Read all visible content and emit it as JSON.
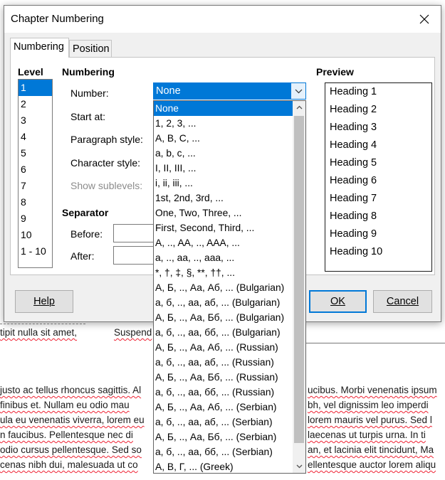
{
  "document": {
    "lines": [
      "justo ac tellus rhoncus sagittis. Al",
      "finibus et. Nullam eu odio mau",
      "ula eu venenatis viverra, lorem eu",
      "n faucibus. Pellentesque nec di",
      "odio cursus pellentesque. Sed so",
      "cenas nibh dui, malesuada ut co"
    ],
    "right_lines": [
      "ucibus. Morbi venenatis ipsum",
      "bh, vel dignissim leo imperdi",
      "lorem mauris vel purus. Sed l",
      "laecenas ut turpis urna. In ti",
      "an, et lacinia elit tincidunt, Ma",
      "ellentesque auctor lorem aliqu"
    ],
    "under_dialog_left": "tipit nulla sit amet,",
    "under_dialog_right": "Suspend"
  },
  "dialog": {
    "title": "Chapter Numbering",
    "tabs": [
      "Numbering",
      "Position"
    ],
    "level_header": "Level",
    "levels": [
      "1",
      "2",
      "3",
      "4",
      "5",
      "6",
      "7",
      "8",
      "9",
      "10",
      "1 - 10"
    ],
    "selected_level": "1",
    "numbering_header": "Numbering",
    "number_label": "Number:",
    "start_at_label": "Start at:",
    "paragraph_style_label": "Paragraph style:",
    "character_style_label": "Character style:",
    "show_sublevels_label": "Show sublevels:",
    "separator_header": "Separator",
    "before_label": "Before:",
    "after_label": "After:",
    "preview_header": "Preview",
    "preview": [
      "Heading 1",
      "Heading 2",
      "Heading 3",
      "Heading 4",
      "Heading 5",
      "Heading 6",
      "Heading 7",
      "Heading 8",
      "Heading 9",
      "Heading 10"
    ],
    "number_value": "None",
    "buttons": {
      "help": "Help",
      "ok": "OK",
      "cancel": "Cancel"
    }
  },
  "number_dropdown": {
    "selected": "None",
    "options": [
      "None",
      "1, 2, 3, ...",
      "A, B, C, ...",
      "a, b, c, ...",
      "I, II, III, ...",
      "i, ii, iii, ...",
      "1st, 2nd, 3rd, ...",
      "One, Two, Three, ...",
      "First, Second, Third, ...",
      "A, .., AA, .., AAA, ...",
      "a, .., aa, .., aaa, ...",
      "*, †, ‡, §, **, ††, ...",
      "А, Б, .., Аа, Аб, ... (Bulgarian)",
      "а, б, .., аа, аб, ... (Bulgarian)",
      "А, Б, .., Аа, Бб, ... (Bulgarian)",
      "а, б, .., аа, бб, ... (Bulgarian)",
      "А, Б, .., Аа, Аб, ... (Russian)",
      "а, б, .., аа, аб, ... (Russian)",
      "А, Б, .., Аа, Бб, ... (Russian)",
      "а, б, .., аа, бб, ... (Russian)",
      "А, Б, .., Аа, Аб, ... (Serbian)",
      "а, б, .., аа, аб, ... (Serbian)",
      "А, Б, .., Аа, Бб, ... (Serbian)",
      "а, б, .., аа, бб, ... (Serbian)",
      "Α, Β, Γ, ... (Greek)"
    ]
  },
  "colors": {
    "selection": "#0078d7",
    "dialog_bg": "#f0f0f0",
    "spell_underline": "#e23"
  }
}
